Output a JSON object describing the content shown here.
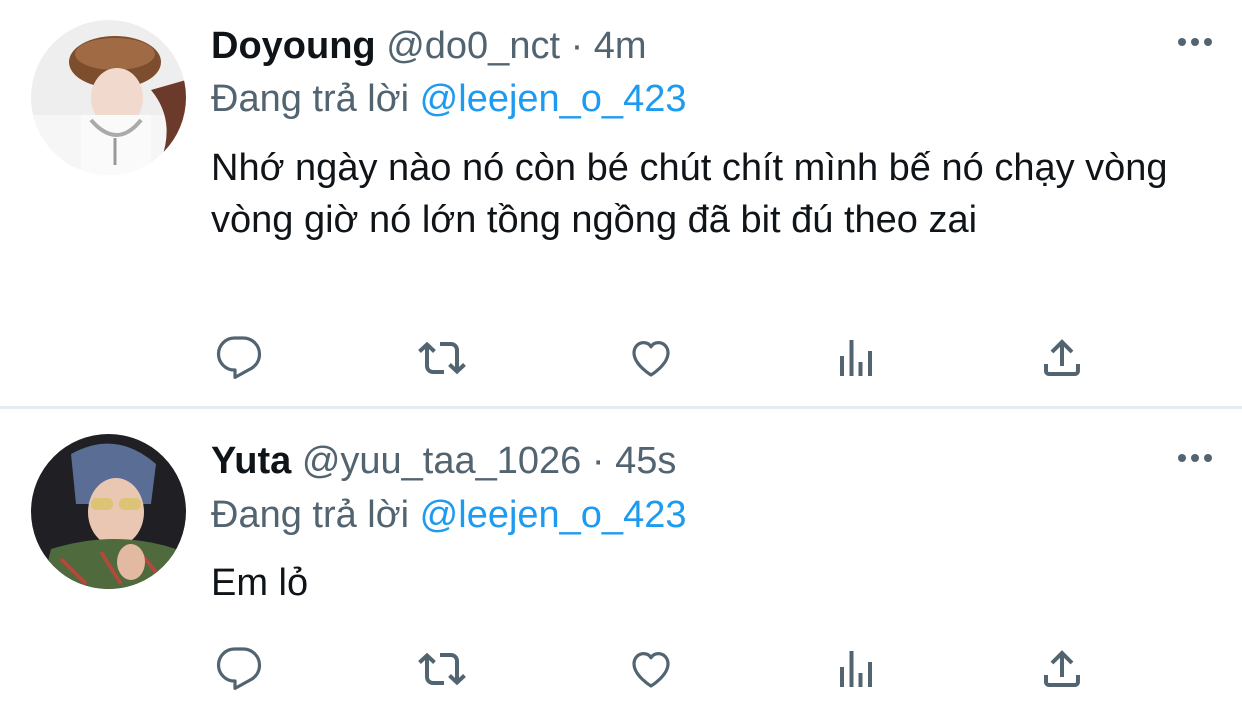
{
  "tweets": [
    {
      "name": "Doyoung",
      "handle": "@do0_nct",
      "separator": "·",
      "time": "4m",
      "reply_prefix": "Đang trả lời ",
      "reply_to": "@leejen_o_423",
      "text": "Nhớ ngày nào nó còn bé chút chít mình bế nó chạy vòng vòng giờ nó lớn tồng ngồng đã bit đú theo zai"
    },
    {
      "name": "Yuta",
      "handle": "@yuu_taa_1026",
      "separator": "·",
      "time": "45s",
      "reply_prefix": "Đang trả lời ",
      "reply_to": "@leejen_o_423",
      "text": "Em lỏ"
    }
  ],
  "colors": {
    "text_primary": "#0f1419",
    "text_secondary": "#536471",
    "mention": "#1d9bf0",
    "divider": "#e6ecf0"
  },
  "icons": [
    "reply-icon",
    "retweet-icon",
    "like-icon",
    "stats-icon",
    "share-icon",
    "more-icon"
  ]
}
